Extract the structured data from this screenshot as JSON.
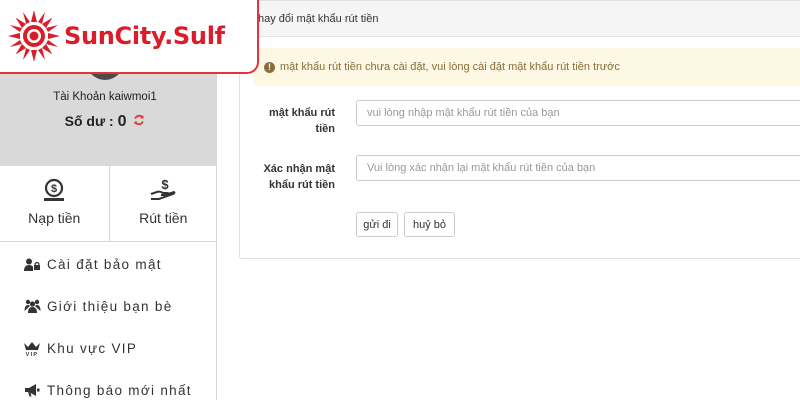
{
  "logo": {
    "text": "SunCity.Sulf"
  },
  "account": {
    "name": "Tài Khoản kaiwmoi1",
    "balance_label": "Số dư :",
    "balance_value": "0",
    "refresh_icon": "refresh-icon"
  },
  "actions": [
    {
      "label": "Nạp tiền",
      "icon": "money-bag-icon"
    },
    {
      "label": "Rút tiền",
      "icon": "hand-dollar-icon"
    }
  ],
  "menu": [
    {
      "label": "Cài đặt bảo mật",
      "icon": "user-lock-icon"
    },
    {
      "label": "Giới thiệu bạn bè",
      "icon": "users-icon"
    },
    {
      "label": "Khu vực VIP",
      "icon": "vip-crown-icon"
    },
    {
      "label": "Thông báo mới nhất",
      "icon": "megaphone-icon"
    }
  ],
  "panel": {
    "title": "hay đổi mật khẩu rút tiền",
    "alert": "mật khẩu rút tiền chưa cài đặt, vui lòng cài đặt mật khẩu rút tiền trước",
    "fields": [
      {
        "label_line1": "mật khẩu rút",
        "label_line2": "tiền",
        "placeholder": "vui lòng nhập mật khẩu rút tiền của bạn",
        "value": ""
      },
      {
        "label_line1": "Xác nhận mật",
        "label_line2": "khẩu rút tiền",
        "placeholder": "Vui lòng xác nhận lại mật khẩu rút tiền của bạn",
        "value": ""
      }
    ],
    "submit_label": "gửi đi",
    "cancel_label": "huỷ bỏ"
  },
  "colors": {
    "brand_red": "#dd1c2a",
    "sidebar_gray": "#d9d9d9",
    "alert_bg": "#fcf8e3",
    "alert_text": "#8a6d3b"
  }
}
